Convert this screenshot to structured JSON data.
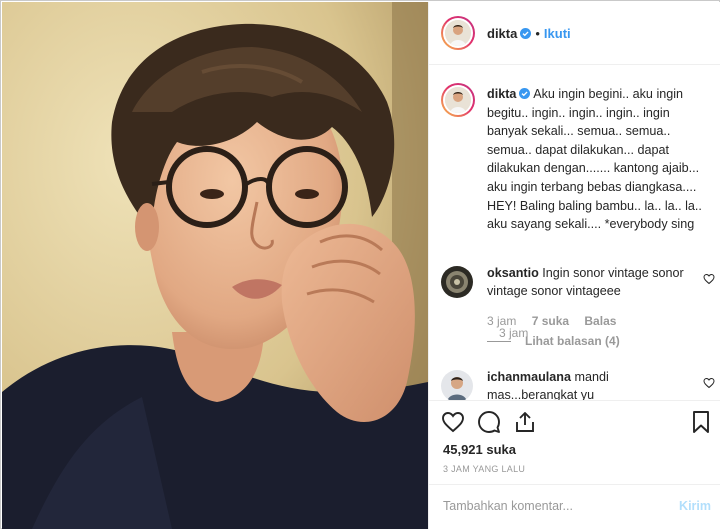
{
  "post": {
    "username": "dikta",
    "verified_icon": "verified-badge-icon",
    "separator": "•",
    "follow_label": "Ikuti"
  },
  "caption": {
    "username": "dikta",
    "text": "Aku ingin begini.. aku ingin begitu.. ingin.. ingin.. ingin.. ingin banyak sekali... semua.. semua.. semua.. dapat dilakukan... dapat dilakukan dengan....... kantong ajaib... aku ingin terbang bebas diangkasa.... HEY! Baling baling bambu.. la.. la.. la.. aku sayang sekali.... *everybody sing",
    "time": "3 jam"
  },
  "comments": [
    {
      "username": "oksantio",
      "text": "Ingin sonor vintage sonor vintage sonor vintageee",
      "time": "3 jam",
      "likes": "7 suka",
      "reply_label": "Balas",
      "view_replies": "Lihat balasan (4)"
    },
    {
      "username": "ichanmaulana",
      "text": "mandi mas...berangkat yu"
    }
  ],
  "actions": {
    "like_icon": "heart-icon",
    "comment_icon": "comment-icon",
    "share_icon": "share-icon",
    "save_icon": "bookmark-icon"
  },
  "likes_count": "45,921 suka",
  "posted_time": "3 JAM YANG LALU",
  "add_comment": {
    "placeholder": "Tambahkan komentar...",
    "post_label": "Kirim"
  },
  "colors": {
    "accent": "#3897f0",
    "text": "#262626",
    "muted": "#999999",
    "post_disabled": "#b2dffc"
  }
}
